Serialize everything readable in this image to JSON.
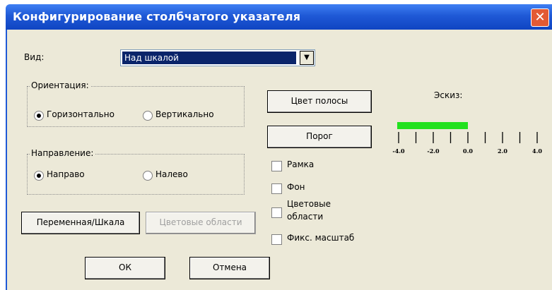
{
  "window": {
    "title": "Конфигурирование столбчатого указателя",
    "close_glyph": "✕"
  },
  "view": {
    "label": "Вид:",
    "selected": "Над шкалой"
  },
  "orientation": {
    "legend": "Ориентация:",
    "horizontal": "Горизонтально",
    "vertical": "Вертикально",
    "selected": "horizontal"
  },
  "direction": {
    "legend": "Направление:",
    "right": "Направо",
    "left": "Налево",
    "selected": "right"
  },
  "buttons": {
    "bar_color": "Цвет полосы",
    "threshold": "Порог",
    "variable_scale": "Переменная/Шкала",
    "color_areas": "Цветовые области",
    "ok": "ОК",
    "cancel": "Отмена"
  },
  "checkboxes": {
    "frame": "Рамка",
    "background": "Фон",
    "color_areas_line1": "Цветовые",
    "color_areas_line2": "области",
    "fixed_scale": "Фикс. масштаб"
  },
  "preview": {
    "label": "Эскиз:",
    "bar_color": "#22e11e",
    "tick_labels": [
      "-4.0",
      "-2.0",
      "0.0",
      "2.0",
      "4.0"
    ]
  }
}
